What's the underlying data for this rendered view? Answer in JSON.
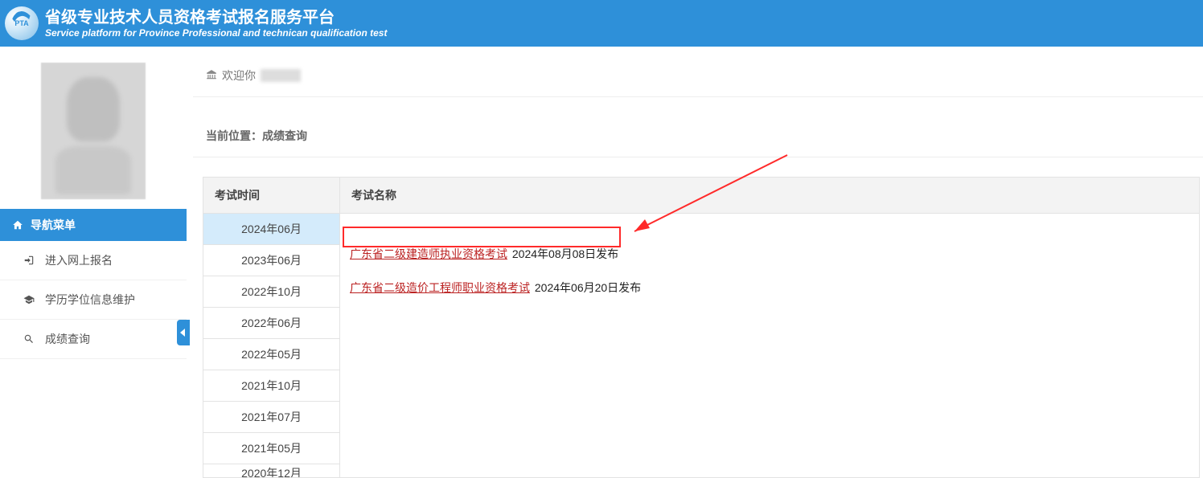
{
  "header": {
    "logo_text": "PTA",
    "title_cn": "省级专业技术人员资格考试报名服务平台",
    "title_en": "Service platform for Province Professional and technican qualification test"
  },
  "sidebar": {
    "menu_header": "导航菜单",
    "items": [
      {
        "icon": "login-icon",
        "label": "进入网上报名"
      },
      {
        "icon": "graduation-icon",
        "label": "学历学位信息维护"
      },
      {
        "icon": "search-icon",
        "label": "成绩查询"
      }
    ]
  },
  "welcome": {
    "prefix": "欢迎你"
  },
  "breadcrumb": {
    "label": "当前位置：",
    "current": "成绩查询"
  },
  "table": {
    "col_time": "考试时间",
    "col_name": "考试名称",
    "times": [
      "2024年06月",
      "2023年06月",
      "2022年10月",
      "2022年06月",
      "2022年05月",
      "2021年10月",
      "2021年07月",
      "2021年05月",
      "2020年12月"
    ],
    "active_index": 0,
    "exams": [
      {
        "name": "广东省二级建造师执业资格考试",
        "publish": "2024年08月08日发布",
        "highlighted": true
      },
      {
        "name": "广东省二级造价工程师职业资格考试",
        "publish": "2024年06月20日发布",
        "highlighted": false
      }
    ]
  }
}
